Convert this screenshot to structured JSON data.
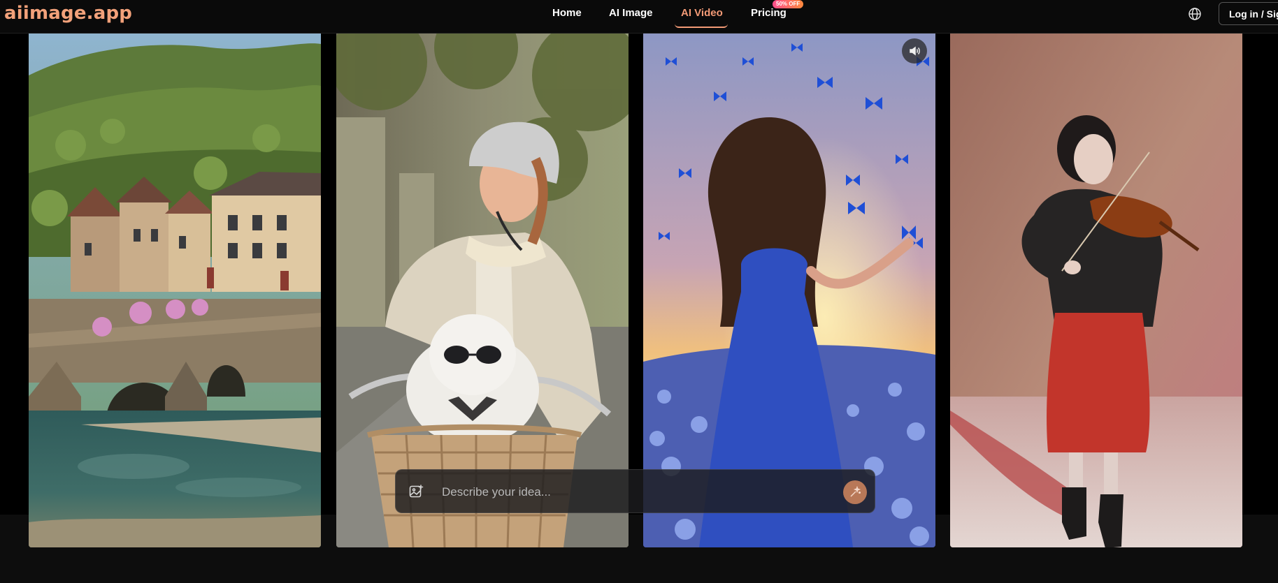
{
  "header": {
    "logo": "aiimage.app",
    "nav": [
      {
        "label": "Home"
      },
      {
        "label": "AI Image"
      },
      {
        "label": "AI Video"
      },
      {
        "label": "Pricing"
      }
    ],
    "pricing_badge": "50% OFF",
    "login_label": "Log in / Sign up"
  },
  "gallery": {
    "cards": [
      {
        "name": "village-bridge-video"
      },
      {
        "name": "cyclist-dog-video"
      },
      {
        "name": "butterfly-field-video"
      },
      {
        "name": "violinist-video"
      }
    ],
    "sound_icon": "speaker-icon"
  },
  "prompt": {
    "placeholder": "Describe your idea...",
    "upload_icon": "image-upload-icon",
    "generate_icon": "sparkle-icon"
  },
  "colors": {
    "accent": "#f39a76",
    "background": "#000000",
    "header_bg": "#0a0a0a"
  }
}
